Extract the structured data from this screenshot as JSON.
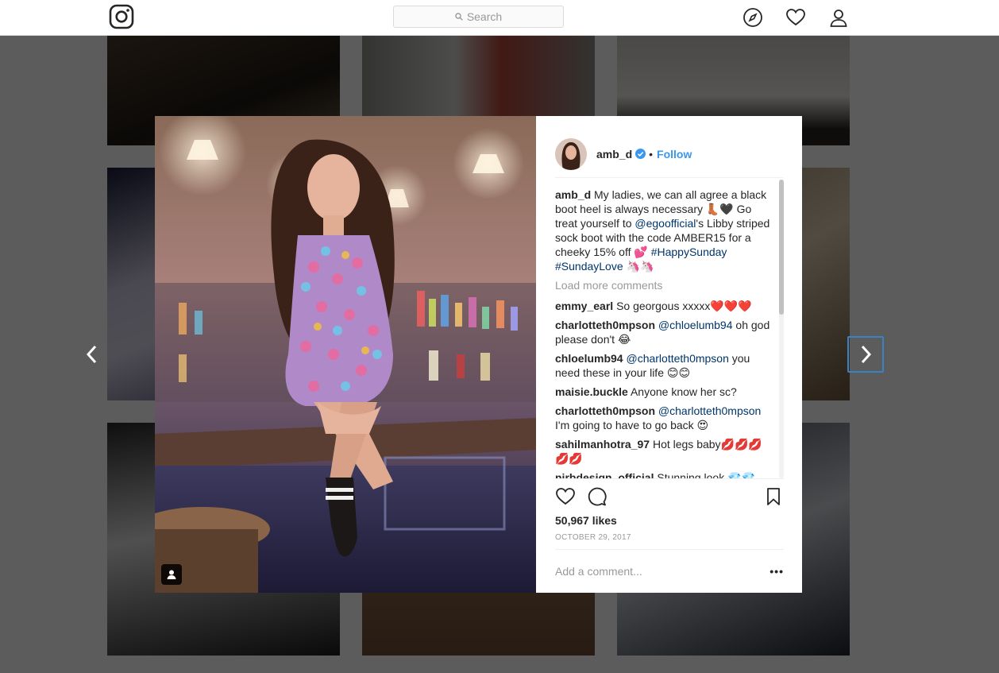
{
  "nav": {
    "search_placeholder": "Search"
  },
  "post": {
    "username": "amb_d",
    "follow_label": "Follow",
    "separator": "•",
    "caption": {
      "user": "amb_d",
      "text_1": "My ladies, we can all agree a black boot heel is always necessary 👢🖤 Go treat yourself to ",
      "mention": "@egoofficial",
      "text_2": "'s Libby striped sock boot with the code AMBER15 for a cheeky 15% off 💕",
      "hashtag_1": "#HappySunday",
      "hashtag_2": "#SundayLove",
      "text_3": "🦄🦄"
    },
    "load_more": "Load more comments",
    "comments": [
      {
        "user": "emmy_earl",
        "mention": "",
        "text": "So georgous xxxxx❤️❤️❤️"
      },
      {
        "user": "charlotteth0mpson",
        "mention": "@chloelumb94",
        "text": "oh god please don't 😂"
      },
      {
        "user": "chloelumb94",
        "mention": "@charlotteth0mpson",
        "text": "you need these in your life 😊😊"
      },
      {
        "user": "maisie.buckle",
        "mention": "",
        "text": "Anyone know her sc?"
      },
      {
        "user": "charlotteth0mpson",
        "mention": "@charlotteth0mpson",
        "text": "I'm going to have to go back 😍"
      },
      {
        "user": "sahilmanhotra_97",
        "mention": "",
        "text": "Hot legs baby💋💋💋💋💋"
      },
      {
        "user": "nirbdesign_official",
        "mention": "",
        "text": "Stunning look 💎💎"
      }
    ],
    "likes": "50,967 likes",
    "date": "OCTOBER 29, 2017",
    "add_comment_placeholder": "Add a comment...",
    "more_label": "•••"
  }
}
